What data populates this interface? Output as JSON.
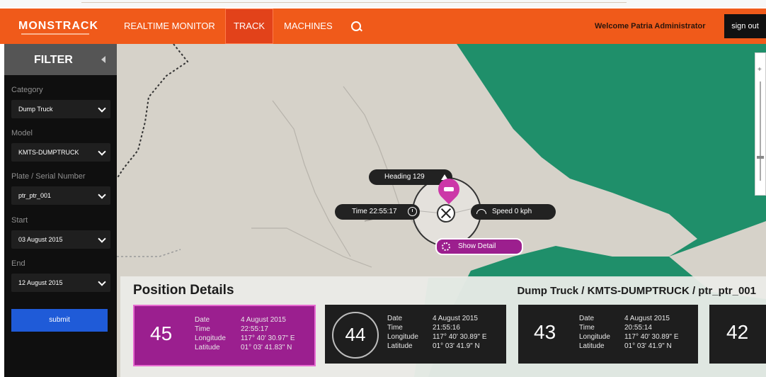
{
  "header": {
    "logo": "MONSTRACK",
    "nav": [
      "REALTIME MONITOR",
      "TRACK",
      "MACHINES"
    ],
    "active_nav": "TRACK",
    "welcome": "Welcome Patria Administrator",
    "signout": "sign out"
  },
  "sidebar": {
    "title": "FILTER",
    "fields": [
      {
        "label": "Category",
        "value": "Dump Truck"
      },
      {
        "label": "Model",
        "value": "KMTS-DUMPTRUCK"
      },
      {
        "label": "Plate / Serial Number",
        "value": "ptr_ptr_001"
      },
      {
        "label": "Start",
        "value": "03 August 2015"
      },
      {
        "label": "End",
        "value": "12 August 2015"
      }
    ],
    "submit": "submit"
  },
  "map": {
    "heading": "Heading 129",
    "time": "Time 22:55:17",
    "speed": "Speed 0 kph",
    "show_detail": "Show Detail",
    "colors": {
      "land": "#d6d2c9",
      "sea": "#1f8f6a",
      "highlight": "#cc38a8"
    }
  },
  "details": {
    "title": "Position Details",
    "path": "Dump Truck / KMTS-DUMPTRUCK / ptr_ptr_001",
    "keys": [
      "Date",
      "Time",
      "Longitude",
      "Latitude"
    ],
    "cards": [
      {
        "num": "45",
        "date": "4 August 2015",
        "time": "22:55:17",
        "lon": "117° 40' 30.97\" E",
        "lat": "01° 03' 41.83\" N"
      },
      {
        "num": "44",
        "date": "4 August 2015",
        "time": "21:55:16",
        "lon": "117° 40' 30.89\" E",
        "lat": "01° 03' 41.9\" N"
      },
      {
        "num": "43",
        "date": "4 August 2015",
        "time": "20:55:14",
        "lon": "117° 40' 30.89\" E",
        "lat": "01° 03' 41.9\" N"
      },
      {
        "num": "42"
      }
    ]
  }
}
